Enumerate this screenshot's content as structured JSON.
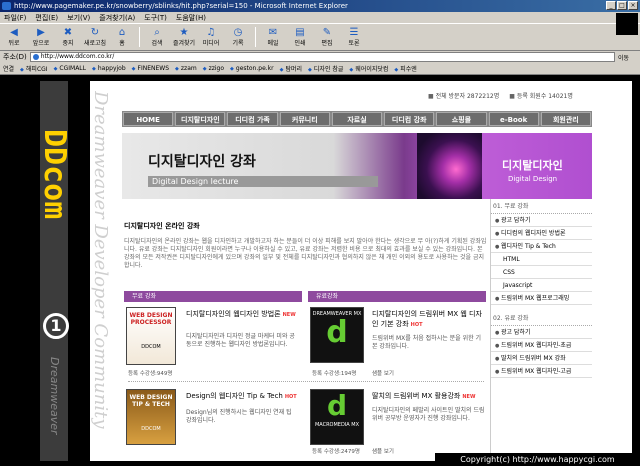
{
  "window": {
    "title": "http://www.pagemaker.pe.kr/snowberry/sblinks/hit.php?serial=150 - Microsoft Internet Explorer",
    "controls": [
      "_",
      "□",
      "×"
    ]
  },
  "menu": [
    "파일(F)",
    "편집(E)",
    "보기(V)",
    "즐겨찾기(A)",
    "도구(T)",
    "도움말(H)"
  ],
  "toolbar": [
    {
      "label": "뒤로",
      "icon": "back-icon",
      "glyph": "◀"
    },
    {
      "label": "앞으로",
      "icon": "forward-icon",
      "glyph": "▶"
    },
    {
      "label": "중지",
      "icon": "stop-icon",
      "glyph": "✖"
    },
    {
      "label": "새로고침",
      "icon": "refresh-icon",
      "glyph": "↻"
    },
    {
      "label": "홈",
      "icon": "home-icon",
      "glyph": "⌂"
    },
    {
      "label": "검색",
      "icon": "search-icon",
      "glyph": "⌕"
    },
    {
      "label": "즐겨찾기",
      "icon": "favorites-icon",
      "glyph": "★"
    },
    {
      "label": "미디어",
      "icon": "media-icon",
      "glyph": "♫"
    },
    {
      "label": "기록",
      "icon": "history-icon",
      "glyph": "◷"
    },
    {
      "label": "메일",
      "icon": "mail-icon",
      "glyph": "✉"
    },
    {
      "label": "인쇄",
      "icon": "print-icon",
      "glyph": "▤"
    },
    {
      "label": "편집",
      "icon": "edit-icon",
      "glyph": "✎"
    },
    {
      "label": "토론",
      "icon": "discuss-icon",
      "glyph": "☰"
    }
  ],
  "address": {
    "label": "주소(D)",
    "url": "http://www.ddcom.co.kr/",
    "go": "이동"
  },
  "links": {
    "label": "연결",
    "items": [
      "해피CGI",
      "CGIMALL",
      "happyjob",
      "FINENEWS",
      "zzam",
      "zzigo",
      "geston.pe.kr",
      "탐머리",
      "디자인 참글",
      "웨어이지닷컴",
      "피수엔"
    ]
  },
  "sidebar": {
    "logo": "DDcom",
    "number": "1",
    "vertical": "Dreamweaver",
    "script": "Dreamweaver Developer Community"
  },
  "stats": {
    "visitors": "전체 방문자 2872212명",
    "members": "등록 회원수 14021명"
  },
  "nav": [
    "HOME",
    "디지탈디자인",
    "디디컴 가족",
    "커뮤니티",
    "자료실",
    "디디컴 강좌",
    "쇼핑몰",
    "e-Book",
    "회원관리"
  ],
  "banner": {
    "title": "디지탈디자인 강좌",
    "subtitle": "Digital Design lecture",
    "right_title": "디지탈디자인",
    "right_sub": "Digital Design"
  },
  "intro": {
    "heading": "디지탈디자인 온라인 강좌",
    "body": "디지탈디자인의 온라인 강좌는 웹을 디자인하고 개발하고자 하는 분들이 더 이상 피해를 보지 말아야 한다는 생각으로 무 아(?)하게 기획된 강좌입니다. 유료 강좌는 디지탈디자인 회원이라면 누구나 이용하실 수 있고, 유료 강좌는 저렴한 비용 으로 최대의 효과를 보실 수 있는 강좌입니다. 본 강좌의 모든 저작권은 디지탈디자인에게 있으며 강좌의 일부 및 전체를 디지탈디자인과 협의하지 않은 채 개인 이외의 용도로 사용하는 것을 금지합니다."
  },
  "sections": {
    "paid": "무료 강좌",
    "free": "유료강좌"
  },
  "cards": [
    {
      "img_text": "WEB DESIGN PROCESSOR",
      "img_brand": "DDCOM",
      "title": "디지탈디자인의 웹디자인 방법론",
      "badge": "NEW",
      "desc": "디지탈디자인과 디자인 정글 마케터 미와 공동으로 진행하는 웹디자인 방법론입니다.",
      "meta": "등록 수강생:949명"
    },
    {
      "img_text": "DREAMWEAVER MX",
      "img_brand": "d",
      "title": "디지탈디자인의 드림위버 MX 웹 디자인 기본 강좌",
      "badge": "HOT",
      "desc": "드림위버 MX를 처음 접하시는 분을 위한 기본 강좌입니다.",
      "meta": "등록 수강생:194명",
      "more": "샘플 보기"
    },
    {
      "img_text": "WEB DESIGN TIP & TECH",
      "img_brand": "DDCOM",
      "title": "Design의 웹디자인 Tip & Tech",
      "badge": "HOT",
      "desc": "Design님의 진행하시는 웹디자인 연재 팁 강좌입니다."
    },
    {
      "img_text": "MACROMEDIA MX",
      "img_brand": "d",
      "title": "딸치의 드림위버 MX 활용강좌",
      "badge": "NEW",
      "desc": "디지탈디자인의 페발리 사이트인 딸치의 드림위버 공부방 운영자가 진행 강좌입니다.",
      "meta": "등록 수강생:2479명",
      "more": "샘플 보기"
    }
  ],
  "right": {
    "h1": "01. 무료 강좌",
    "items1": [
      "광고 답하기",
      "디디컴의 웹디자인 방법론",
      "웹디자인 Tip & Tech",
      "HTML",
      "CSS",
      "Javascript",
      "드림위버 MX 웹프로그래밍"
    ],
    "h2": "02. 유료 강좌",
    "items2": [
      "광고 답하기",
      "드림위버 MX 웹디자인-초급",
      "딸치의 드림위버 MX 강좌",
      "드림위버 MX 웹디자인-고급"
    ]
  },
  "status": "Copyright(c) http://www.happycgi.com"
}
